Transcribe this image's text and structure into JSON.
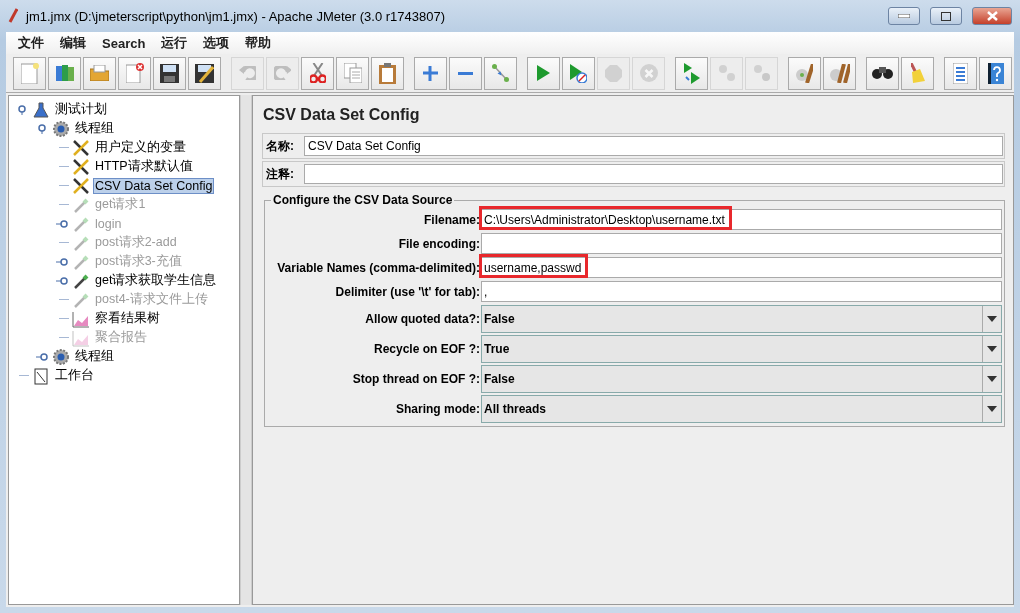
{
  "window": {
    "title": "jm1.jmx (D:\\jmeterscript\\python\\jm1.jmx) - Apache JMeter (3.0 r1743807)"
  },
  "menu": [
    "文件",
    "编辑",
    "Search",
    "运行",
    "选项",
    "帮助"
  ],
  "toolbar": {
    "groups": [
      {
        "buttons": [
          {
            "kind": "new",
            "disabled": false
          },
          {
            "kind": "templates",
            "disabled": false
          },
          {
            "kind": "open",
            "disabled": false
          },
          {
            "kind": "close",
            "disabled": false
          },
          {
            "kind": "save",
            "disabled": false
          },
          {
            "kind": "saveas",
            "disabled": false
          }
        ]
      },
      {
        "buttons": [
          {
            "kind": "undo",
            "disabled": true
          },
          {
            "kind": "redo",
            "disabled": true
          },
          {
            "kind": "cut",
            "disabled": false
          },
          {
            "kind": "copy",
            "disabled": false
          },
          {
            "kind": "paste",
            "disabled": false
          }
        ]
      },
      {
        "buttons": [
          {
            "kind": "expand",
            "disabled": false
          },
          {
            "kind": "collapse",
            "disabled": false
          },
          {
            "kind": "toggle",
            "disabled": false
          }
        ]
      },
      {
        "buttons": [
          {
            "kind": "start",
            "disabled": false
          },
          {
            "kind": "start-nopause",
            "disabled": false
          },
          {
            "kind": "stop",
            "disabled": true
          },
          {
            "kind": "shutdown",
            "disabled": true
          }
        ]
      },
      {
        "buttons": [
          {
            "kind": "remote-start",
            "disabled": false
          },
          {
            "kind": "remote-stop",
            "disabled": true
          },
          {
            "kind": "remote-shutdown",
            "disabled": true
          }
        ]
      },
      {
        "buttons": [
          {
            "kind": "clear",
            "disabled": false
          },
          {
            "kind": "clear-all",
            "disabled": false
          }
        ]
      },
      {
        "buttons": [
          {
            "kind": "search",
            "disabled": false
          },
          {
            "kind": "reset-search",
            "disabled": false
          }
        ]
      },
      {
        "buttons": [
          {
            "kind": "functions",
            "disabled": false
          },
          {
            "kind": "help",
            "disabled": false
          }
        ]
      }
    ]
  },
  "tree": [
    {
      "label": "测试计划",
      "kind": "plan",
      "disabled": false,
      "selected": false,
      "expanded": true,
      "children": [
        {
          "label": "线程组",
          "kind": "threadgroup",
          "disabled": false,
          "selected": false,
          "expanded": true,
          "children": [
            {
              "label": "用户定义的变量",
              "kind": "config",
              "disabled": false,
              "selected": false
            },
            {
              "label": "HTTP请求默认值",
              "kind": "config",
              "disabled": false,
              "selected": false
            },
            {
              "label": "CSV Data Set Config",
              "kind": "config",
              "disabled": false,
              "selected": true
            },
            {
              "label": "get请求1",
              "kind": "sampler",
              "disabled": true,
              "selected": false
            },
            {
              "label": "login",
              "kind": "sampler",
              "disabled": true,
              "selected": false,
              "expanded": false
            },
            {
              "label": "post请求2-add",
              "kind": "sampler",
              "disabled": true,
              "selected": false
            },
            {
              "label": "post请求3-充值",
              "kind": "sampler",
              "disabled": true,
              "selected": false,
              "expanded": false
            },
            {
              "label": "get请求获取学生信息",
              "kind": "sampler",
              "disabled": false,
              "selected": false,
              "expanded": false
            },
            {
              "label": "post4-请求文件上传",
              "kind": "sampler",
              "disabled": true,
              "selected": false
            },
            {
              "label": "察看结果树",
              "kind": "listener",
              "disabled": false,
              "selected": false
            },
            {
              "label": "聚合报告",
              "kind": "listener",
              "disabled": true,
              "selected": false
            }
          ]
        },
        {
          "label": "线程组",
          "kind": "threadgroup",
          "disabled": false,
          "selected": false,
          "expanded": false
        }
      ]
    },
    {
      "label": "工作台",
      "kind": "workbench",
      "disabled": false,
      "selected": false
    }
  ],
  "editor": {
    "title": "CSV Data Set Config",
    "name_label": "名称:",
    "name_value": "CSV Data Set Config",
    "comment_label": "注释:",
    "legend": "Configure the CSV Data Source",
    "rows": [
      {
        "label": "Filename:",
        "value": "C:\\Users\\Administrator\\Desktop\\username.txt",
        "kind": "text",
        "highlighted": true
      },
      {
        "label": "File encoding:",
        "kind": "text",
        "highlighted": false
      },
      {
        "label": "Variable Names (comma-delimited):",
        "value": "username,passwd",
        "kind": "text",
        "highlighted": true
      },
      {
        "label": "Delimiter (use '\\t' for tab):",
        "value": ",",
        "kind": "text",
        "highlighted": false
      },
      {
        "label": "Allow quoted data?:",
        "value": "False",
        "kind": "select",
        "highlighted": false
      },
      {
        "label": "Recycle on EOF ?:",
        "value": "True",
        "kind": "select",
        "highlighted": false
      },
      {
        "label": "Stop thread on EOF ?:",
        "value": "False",
        "kind": "select",
        "highlighted": false
      },
      {
        "label": "Sharing mode:",
        "value": "All threads",
        "kind": "select",
        "highlighted": false
      }
    ]
  }
}
